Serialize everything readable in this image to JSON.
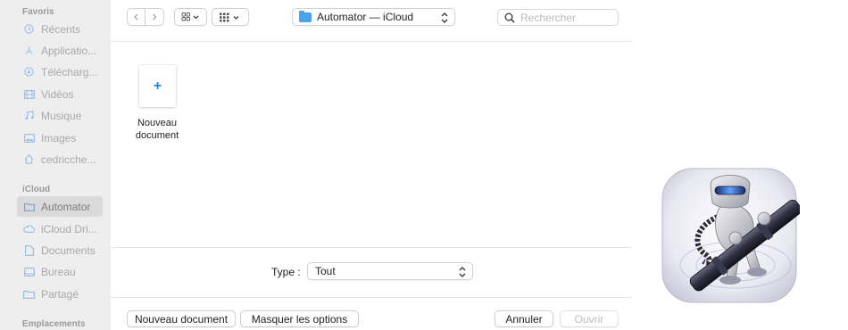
{
  "sidebar": {
    "favorites_title": "Favoris",
    "favorites": [
      {
        "label": "Récents",
        "icon": "clock-icon"
      },
      {
        "label": "Applicatio...",
        "icon": "applications-icon"
      },
      {
        "label": "Télécharg...",
        "icon": "download-icon"
      },
      {
        "label": "Vidéos",
        "icon": "film-icon"
      },
      {
        "label": "Musique",
        "icon": "music-note-icon"
      },
      {
        "label": "Images",
        "icon": "photo-icon"
      },
      {
        "label": "cedricche...",
        "icon": "home-icon"
      }
    ],
    "icloud_title": "iCloud",
    "icloud": [
      {
        "label": "Automator",
        "icon": "folder-icon",
        "selected": true
      },
      {
        "label": "iCloud Dri...",
        "icon": "cloud-icon"
      },
      {
        "label": "Documents",
        "icon": "document-icon"
      },
      {
        "label": "Bureau",
        "icon": "desktop-icon"
      },
      {
        "label": "Partagé",
        "icon": "shared-folder-icon"
      }
    ],
    "locations_title": "Emplacements"
  },
  "toolbar": {
    "back_glyph": "‹",
    "forward_glyph": "›",
    "icon_view_glyph": "⊞ ⌄",
    "group_glyph": "▦ ⌄",
    "location": "Automator — iCloud",
    "search_placeholder": "Rechercher"
  },
  "content": {
    "new_doc_plus": "+",
    "new_doc_label_1": "Nouveau",
    "new_doc_label_2": "document"
  },
  "type_row": {
    "label": "Type :",
    "value": "Tout"
  },
  "footer": {
    "new_document": "Nouveau document",
    "hide_options": "Masquer les options",
    "cancel": "Annuler",
    "open": "Ouvrir"
  },
  "colors": {
    "accent": "#2f7fe0",
    "sidebar_bg": "#eeeeee",
    "folder": "#4aa3e8"
  }
}
